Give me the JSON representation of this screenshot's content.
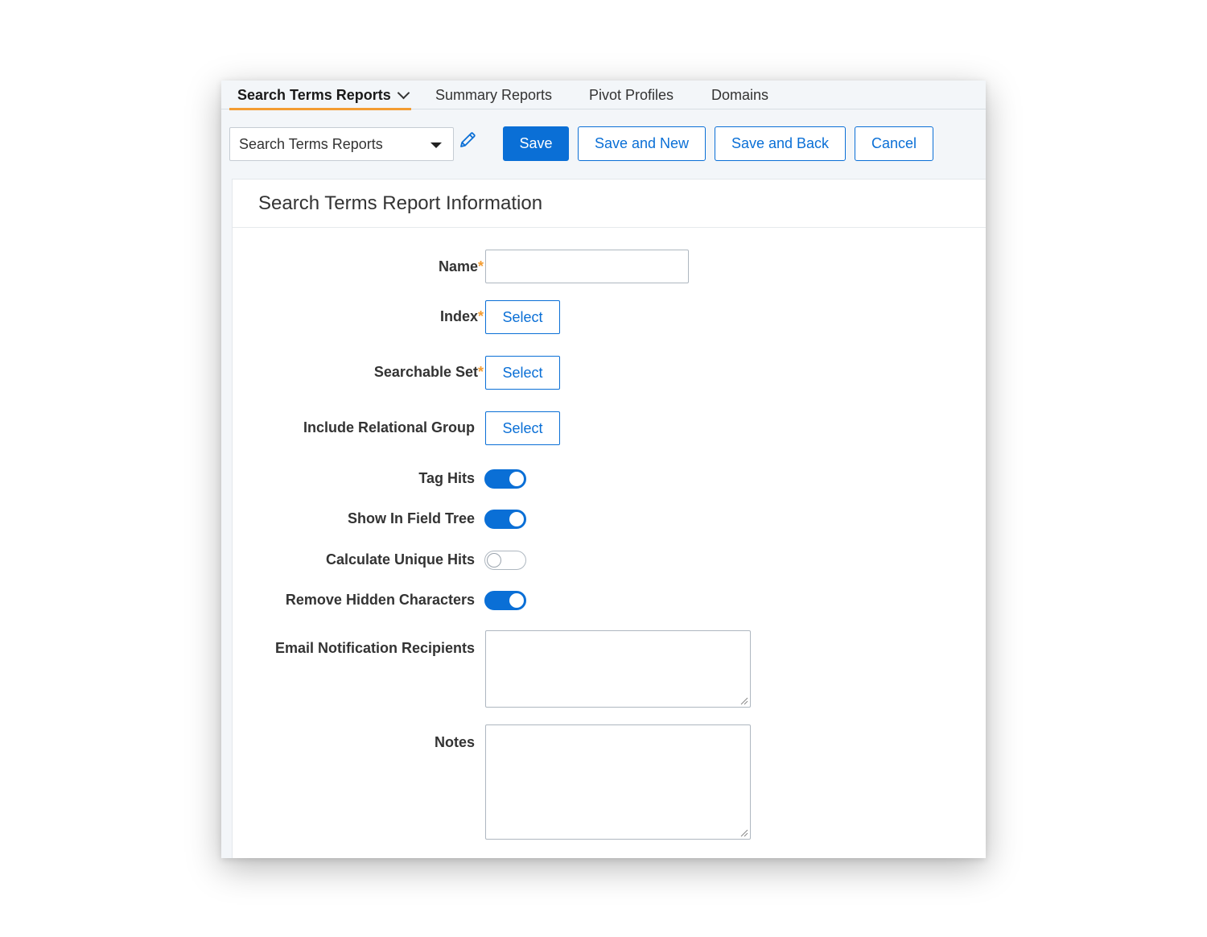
{
  "tabs": [
    {
      "label": "Search Terms Reports",
      "active": true
    },
    {
      "label": "Summary Reports"
    },
    {
      "label": "Pivot Profiles"
    },
    {
      "label": "Domains"
    }
  ],
  "toolbar": {
    "view_select": "Search Terms Reports",
    "save": "Save",
    "save_and_new": "Save and New",
    "save_and_back": "Save and Back",
    "cancel": "Cancel"
  },
  "form": {
    "title": "Search Terms Report Information",
    "required_mark": "*",
    "name_label": "Name",
    "index_label": "Index",
    "searchable_set_label": "Searchable Set",
    "relational_group_label": "Include Relational Group",
    "select_label": "Select",
    "tag_hits_label": "Tag Hits",
    "show_in_field_tree_label": "Show In Field Tree",
    "calculate_unique_hits_label": "Calculate Unique Hits",
    "remove_hidden_chars_label": "Remove Hidden Characters",
    "email_label": "Email Notification Recipients",
    "notes_label": "Notes",
    "toggles": {
      "tag_hits": true,
      "show_in_field_tree": true,
      "calculate_unique_hits": false,
      "remove_hidden_characters": true
    }
  },
  "colors": {
    "accent": "#0a6fd6",
    "tab_underline": "#f39c32",
    "required": "#f39c32"
  }
}
